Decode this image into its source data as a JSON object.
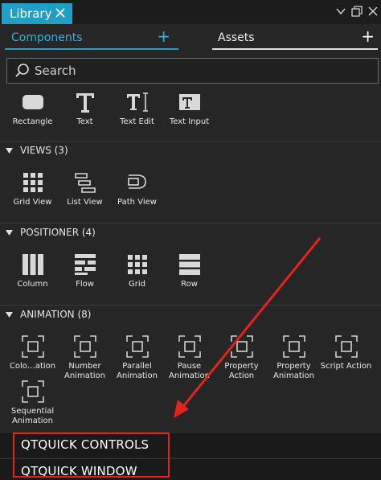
{
  "window": {
    "tab_title": "Library",
    "icons": [
      "close-icon",
      "chevron-down-icon",
      "float-icon",
      "close-icon"
    ]
  },
  "tabs": [
    {
      "label": "Components",
      "add": "+",
      "active": true
    },
    {
      "label": "Assets",
      "add": "+",
      "active": false
    }
  ],
  "search": {
    "placeholder": "Search",
    "value": ""
  },
  "basic_items": [
    {
      "label": "Rectangle",
      "icon": "rectangle-icon"
    },
    {
      "label": "Text",
      "icon": "text-icon"
    },
    {
      "label": "Text Edit",
      "icon": "text-edit-icon"
    },
    {
      "label": "Text Input",
      "icon": "text-input-icon"
    }
  ],
  "sections": {
    "views": {
      "title": "VIEWS (3)",
      "items": [
        {
          "label": "Grid View",
          "icon": "grid-view-icon"
        },
        {
          "label": "List View",
          "icon": "list-view-icon"
        },
        {
          "label": "Path View",
          "icon": "path-view-icon"
        }
      ]
    },
    "positioner": {
      "title": "POSITIONER (4)",
      "items": [
        {
          "label": "Column",
          "icon": "column-icon"
        },
        {
          "label": "Flow",
          "icon": "flow-icon"
        },
        {
          "label": "Grid",
          "icon": "grid-icon"
        },
        {
          "label": "Row",
          "icon": "row-icon"
        }
      ]
    },
    "animation": {
      "title": "ANIMATION (8)",
      "items": [
        {
          "label": "Colo…ation",
          "icon": "animation-icon"
        },
        {
          "label": "Number Animation",
          "icon": "animation-icon"
        },
        {
          "label": "Parallel Animation",
          "icon": "animation-icon"
        },
        {
          "label": "Pause Animation",
          "icon": "animation-icon"
        },
        {
          "label": "Property Action",
          "icon": "animation-icon"
        },
        {
          "label": "Property Animation",
          "icon": "animation-icon"
        },
        {
          "label": "Script Action",
          "icon": "animation-icon"
        },
        {
          "label": "Sequential Animation",
          "icon": "animation-icon"
        }
      ]
    }
  },
  "bottom_sections": [
    {
      "label": "QTQUICK CONTROLS"
    },
    {
      "label": "QTQUICK WINDOW"
    }
  ],
  "annotation": {
    "color": "#e5231b"
  }
}
